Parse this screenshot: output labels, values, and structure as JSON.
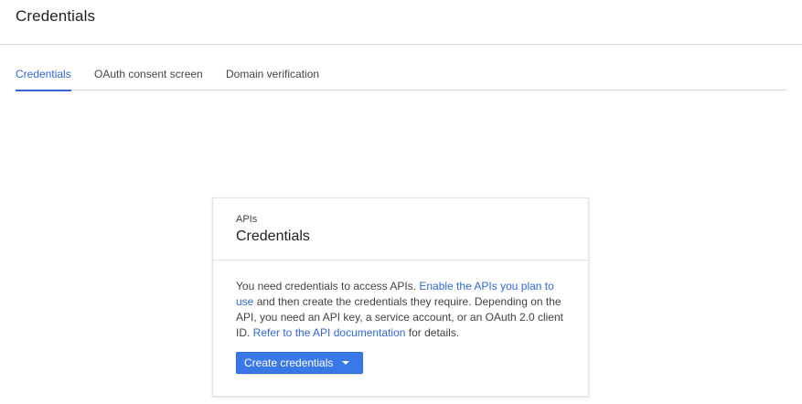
{
  "header": {
    "title": "Credentials"
  },
  "tabs": [
    {
      "label": "Credentials",
      "active": true
    },
    {
      "label": "OAuth consent screen",
      "active": false
    },
    {
      "label": "Domain verification",
      "active": false
    }
  ],
  "card": {
    "eyebrow": "APIs",
    "title": "Credentials",
    "body": {
      "text1": "You need credentials to access APIs. ",
      "link1": "Enable the APIs you plan to use",
      "text2": " and then create the credentials they require. Depending on the API, you need an API key, a service account, or an OAuth 2.0 client ID. ",
      "link2": "Refer to the API documentation",
      "text3": " for details."
    },
    "button": {
      "label": "Create credentials",
      "icon": "caret-down-icon"
    }
  },
  "colors": {
    "accent": "#3367d6",
    "button": "#3b78e7",
    "divider": "#dadada"
  }
}
